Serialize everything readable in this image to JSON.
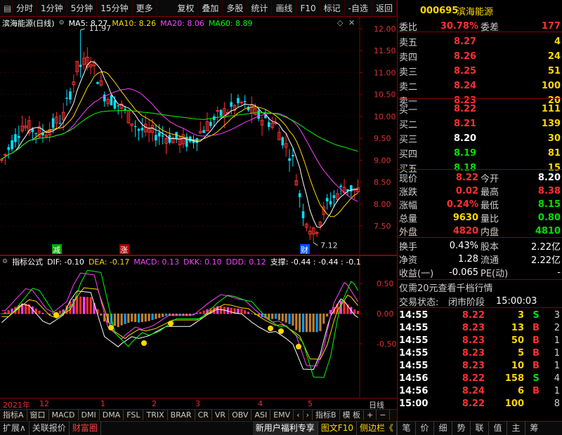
{
  "toolbar": {
    "left": [
      "分时",
      "1分钟",
      "5分钟",
      "15分钟",
      "更多"
    ],
    "more_arrow": "›",
    "right": [
      "复权",
      "叠加",
      "多股",
      "统计",
      "画线",
      "F10",
      "标记",
      "-自选",
      "返回"
    ]
  },
  "main_chart": {
    "stock_label": "滨海能源(日线)",
    "ma5": "MA5: 8.27",
    "ma10": "MA10: 8.26",
    "ma20": "MA20: 8.06",
    "ma60": "MA60: 8.89",
    "y_ticks": [
      "12.00",
      "11.50",
      "11.00",
      "10.50",
      "10.00",
      "9.50",
      "9.00",
      "8.50",
      "8.00",
      "7.50"
    ],
    "high_label": "11.97",
    "low_label": "7.12",
    "tag_jian": "减",
    "tag_zhang": "涨",
    "tag_cai": "财",
    "colors": {
      "ma5": "#ffffff",
      "ma10": "#ffd800",
      "ma20": "#ff40ff",
      "ma60": "#00ff00",
      "up": "#ff3030",
      "down": "#00e0ff"
    }
  },
  "ind_chart": {
    "label": "指标公式",
    "dif": "DIF: -0.10",
    "dea": "DEA: -0.17",
    "macd": "MACD: 0.13",
    "dkk": "DKK: 0.10",
    "ddd": "DDD: 0.12",
    "support": "支撑: -0.44 : -0.44 : -0.1",
    "y_ticks": [
      "0.50",
      "0.00",
      "-0.50"
    ]
  },
  "x_axis": {
    "year": "2021年",
    "months": [
      "12",
      "1",
      "2",
      "3",
      "4",
      "5"
    ],
    "period": "日线"
  },
  "tabs1": [
    "指标A",
    "窗口",
    "MACD",
    "DMI",
    "DMA",
    "FSL",
    "TRIX",
    "BRAR",
    "CR",
    "VR",
    "OBV",
    "ASI",
    "EMV",
    "‹",
    "›",
    "指标B",
    "模 板",
    "+",
    "−"
  ],
  "tabs2": {
    "left": [
      "扩展∧",
      "关联报价",
      "财富圈"
    ],
    "promo": "新用户福利专享",
    "f10": "图文F10",
    "side": "侧边栏《",
    "right": [
      "笔",
      "价",
      "细",
      "势",
      "联",
      "值",
      "主",
      "筹"
    ]
  },
  "quote": {
    "code": "000695",
    "name": "滨海能源",
    "weibi_label": "委比",
    "weibi": "30.78%",
    "weicha_label": "委差",
    "weicha": "177",
    "asks": [
      {
        "label": "卖五",
        "price": "8.27",
        "vol": "4"
      },
      {
        "label": "卖四",
        "price": "8.26",
        "vol": "24"
      },
      {
        "label": "卖三",
        "price": "8.25",
        "vol": "51"
      },
      {
        "label": "卖二",
        "price": "8.24",
        "vol": "100"
      },
      {
        "label": "卖一",
        "price": "8.23",
        "vol": "20"
      }
    ],
    "bids": [
      {
        "label": "买一",
        "price": "8.22",
        "vol": "111",
        "pc": "red"
      },
      {
        "label": "买二",
        "price": "8.21",
        "vol": "139",
        "pc": "red"
      },
      {
        "label": "买三",
        "price": "8.20",
        "vol": "30",
        "pc": "wht"
      },
      {
        "label": "买四",
        "price": "8.19",
        "vol": "81",
        "pc": "grn"
      },
      {
        "label": "买五",
        "price": "8.18",
        "vol": "15",
        "pc": "grn"
      }
    ],
    "stats": [
      {
        "l1": "现价",
        "v1": "8.22",
        "c1": "red",
        "l2": "今开",
        "v2": "8.20",
        "c2": "wht"
      },
      {
        "l1": "涨跌",
        "v1": "0.02",
        "c1": "red",
        "l2": "最高",
        "v2": "8.38",
        "c2": "red"
      },
      {
        "l1": "涨幅",
        "v1": "0.24%",
        "c1": "red",
        "l2": "最低",
        "v2": "8.15",
        "c2": "grn"
      },
      {
        "l1": "总量",
        "v1": "9630",
        "c1": "yel",
        "l2": "量比",
        "v2": "0.80",
        "c2": "grn"
      },
      {
        "l1": "外盘",
        "v1": "4820",
        "c1": "red",
        "l2": "内盘",
        "v2": "4810",
        "c2": "grn"
      }
    ],
    "info": [
      {
        "l1": "换手",
        "v1": "0.43%",
        "l2": "股本",
        "v2": "2.22亿"
      },
      {
        "l1": "净资",
        "v1": "1.28",
        "l2": "流通",
        "v2": "2.22亿"
      },
      {
        "l1": "收益(一)",
        "v1": "-0.065",
        "l2": "PE(动)",
        "v2": "-"
      }
    ],
    "promo": "仅需20元查看千档行情",
    "status_label": "交易状态:",
    "status": "闭市阶段",
    "status_time": "15:00:03",
    "ticks": [
      {
        "t": "14:55",
        "p": "8.22",
        "pc": "red",
        "v": "3",
        "s": "S",
        "sc": "grn",
        "n": "3"
      },
      {
        "t": "14:55",
        "p": "8.23",
        "pc": "red",
        "v": "13",
        "s": "B",
        "sc": "red",
        "n": "2"
      },
      {
        "t": "14:55",
        "p": "8.23",
        "pc": "red",
        "v": "50",
        "s": "B",
        "sc": "red",
        "n": "1"
      },
      {
        "t": "14:55",
        "p": "8.23",
        "pc": "red",
        "v": "5",
        "s": "B",
        "sc": "red",
        "n": "1"
      },
      {
        "t": "14:55",
        "p": "8.23",
        "pc": "red",
        "v": "10",
        "s": "B",
        "sc": "red",
        "n": "1"
      },
      {
        "t": "14:56",
        "p": "8.22",
        "pc": "red",
        "v": "158",
        "s": "S",
        "sc": "grn",
        "n": "4"
      },
      {
        "t": "14:56",
        "p": "8.24",
        "pc": "red",
        "v": "6",
        "s": "B",
        "sc": "red",
        "n": "1"
      },
      {
        "t": "15:00",
        "p": "8.22",
        "pc": "red",
        "v": "100",
        "s": "",
        "sc": "red",
        "n": "8"
      }
    ]
  }
}
